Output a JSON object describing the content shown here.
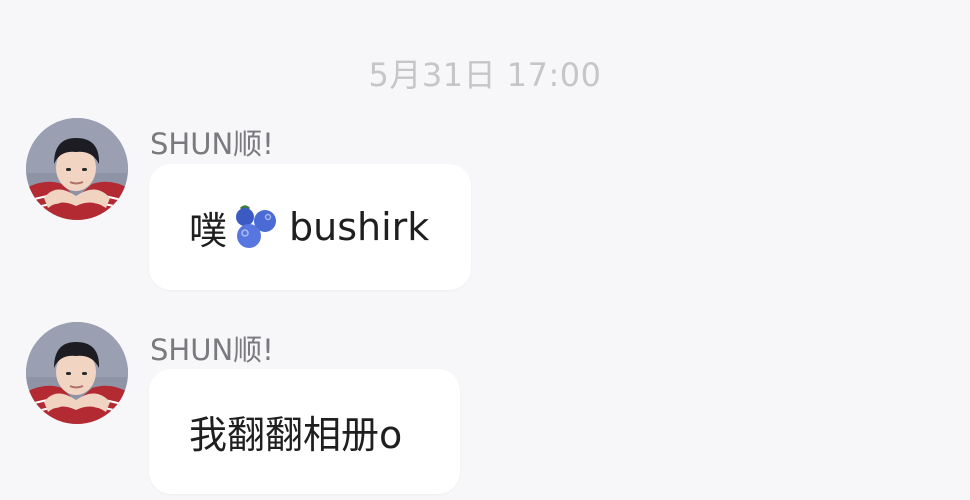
{
  "timestamp": "5月31日 17:00",
  "messages": [
    {
      "sender": "SHUN顺!",
      "text_before": "噗",
      "emoji": "blueberries-icon",
      "text_after": "bushirk"
    },
    {
      "sender": "SHUN顺!",
      "text": "我翻翻相册o"
    }
  ]
}
